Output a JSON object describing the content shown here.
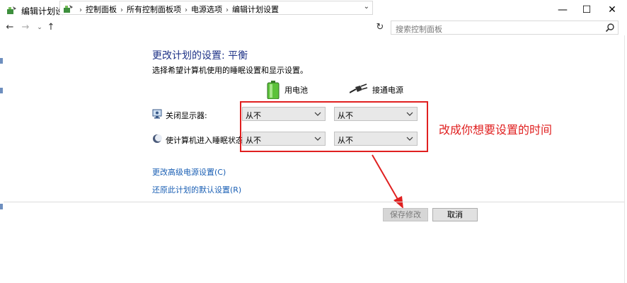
{
  "window": {
    "title": "编辑计划设置",
    "controls": {
      "minimize": "—",
      "maximize": "☐",
      "close": "✕"
    }
  },
  "addressbar": {
    "back": "←",
    "forward": "→",
    "recent": "⌄",
    "up": "↑",
    "breadcrumbs": [
      "控制面板",
      "所有控制面板项",
      "电源选项",
      "编辑计划设置"
    ],
    "separator": "›",
    "dropdown": "⌄",
    "refresh": "↻",
    "search_placeholder": "搜索控制面板"
  },
  "main": {
    "heading": "更改计划的设置: 平衡",
    "subheading": "选择希望计算机使用的睡眠设置和显示设置。",
    "columns": {
      "battery": "用电池",
      "plugged_in": "接通电源"
    },
    "rows": [
      {
        "label": "关闭显示器:",
        "icon": "monitor-icon",
        "battery_value": "从不",
        "plugged_value": "从不"
      },
      {
        "label": "使计算机进入睡眠状态:",
        "icon": "moon-icon",
        "battery_value": "从不",
        "plugged_value": "从不"
      }
    ],
    "links": {
      "advanced": "更改高级电源设置(C)",
      "restore": "还原此计划的默认设置(R)"
    }
  },
  "annotation": {
    "text": "改成你想要设置的时间",
    "color": "#e02020"
  },
  "footer": {
    "save": "保存修改",
    "cancel": "取消"
  },
  "colors": {
    "heading": "#1e3287",
    "link": "#1a5fb4",
    "annotation": "#e02020"
  }
}
